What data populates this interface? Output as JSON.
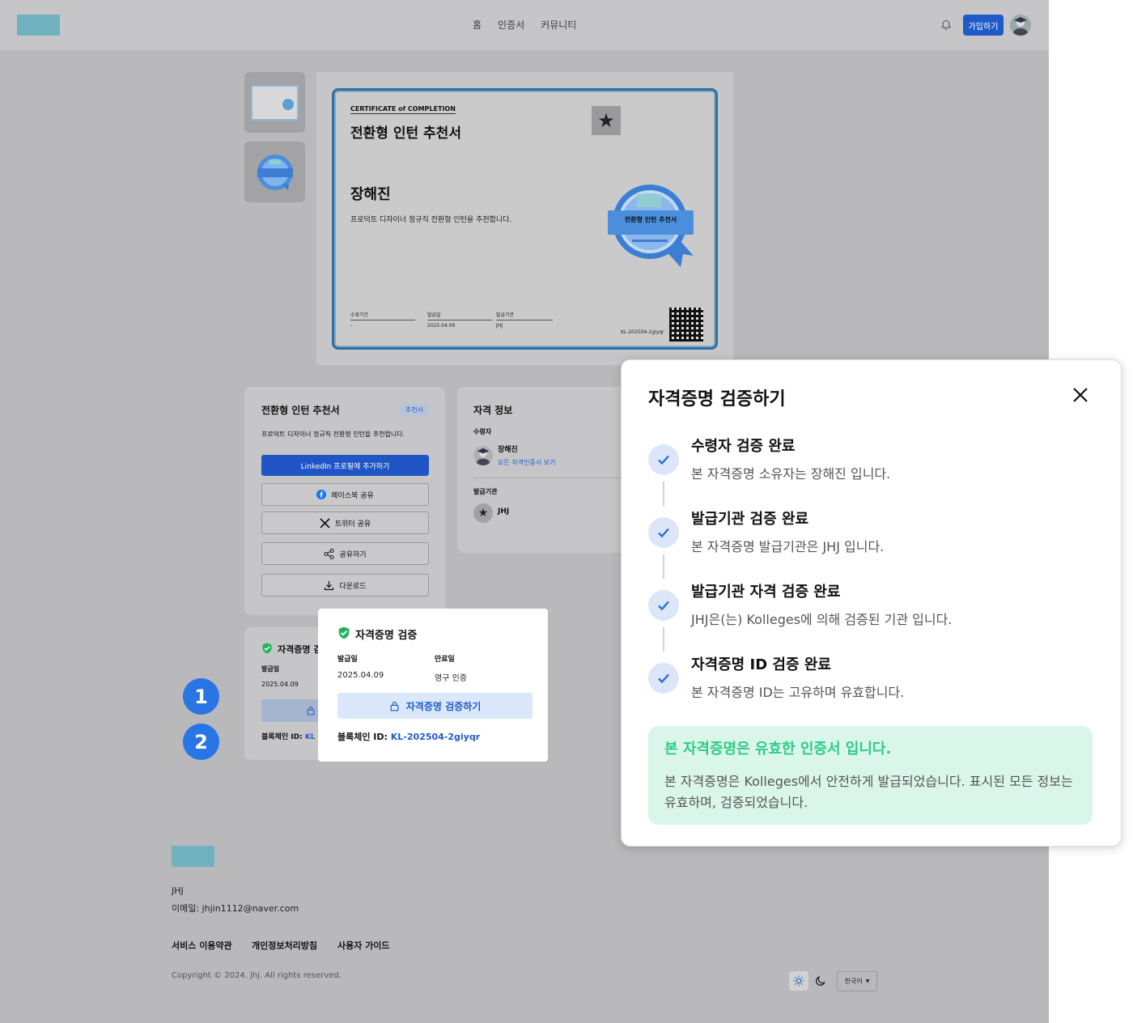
{
  "nav": {
    "items": [
      "홈",
      "인증서",
      "커뮤니티"
    ],
    "join_label": "가입하기"
  },
  "certificate": {
    "small_heading": "CERTIFICATE of COMPLETION",
    "title": "전환형 인턴 추천서",
    "recipient": "장해진",
    "description": "프로덕트 디자이너 정규직 전환형 인턴을 추천합니다.",
    "fields": [
      {
        "label": "수료기간",
        "value": "-"
      },
      {
        "label": "발급일",
        "value": "2025.04.09"
      },
      {
        "label": "발급기관",
        "value": "JHJ"
      }
    ],
    "cert_id": "KL-202504-2giyqr",
    "badge_label": "전환형 인턴 추천서"
  },
  "share_card": {
    "title": "전환형 인턴 추천서",
    "tag": "추천서",
    "description": "프로덕트 디자이너 정규직 전환형 인턴을 추천합니다.",
    "linkedin": "LinkedIn 프로필에 추가하기",
    "facebook": "페이스북 공유",
    "twitter": "트위터 공유",
    "share": "공유하기",
    "download": "다운로드"
  },
  "info_card": {
    "title": "자격 정보",
    "recipient_label": "수령자",
    "recipient_name": "장해진",
    "recipient_link": "모든 자격인증서 보기",
    "issuer_label": "발급기관",
    "issuer_name": "JHJ"
  },
  "verify_card": {
    "title": "자격증명 검증",
    "title_partial": "자격증명 검",
    "issue_label": "발급일",
    "issue_value": "2025.04.09",
    "blockchain_label": "블록체인 ID:",
    "blockchain_partial": "KL"
  },
  "mini_popup": {
    "title": "자격증명 검증",
    "issue_label": "발급일",
    "issue_value": "2025.04.09",
    "expire_label": "만료일",
    "expire_value": "영구 인증",
    "verify_button": "자격증명 검증하기",
    "blockchain_label": "블록체인 ID:",
    "blockchain_value": "KL-202504-2giyqr"
  },
  "markers": [
    "1",
    "2"
  ],
  "modal": {
    "title": "자격증명 검증하기",
    "steps": [
      {
        "title": "수령자 검증 완료",
        "desc": "본 자격증명 소유자는 장해진 입니다."
      },
      {
        "title": "발급기관 검증 완료",
        "desc": "본 자격증명 발급기관은 JHJ 입니다."
      },
      {
        "title": "발급기관 자격 검증 완료",
        "desc": "JHJ은(는) Kolleges에 의해 검증된 기관 입니다."
      },
      {
        "title": "자격증명 ID 검증 완료",
        "desc": "본 자격증명 ID는 고유하며 유효합니다."
      }
    ],
    "valid_title": "본 자격증명은 유효한 인증서 입니다.",
    "valid_desc": "본 자격증명은 Kolleges에서 안전하게 발급되었습니다. 표시된 모든 정보는 유효하며, 검증되었습니다."
  },
  "footer": {
    "company": "JHJ",
    "email": "이메일: jhjin1112@naver.com",
    "links": [
      "서비스 이용약관",
      "개인정보처리방침",
      "사용자 가이드"
    ],
    "copyright": "Copyright © 2024. jhj.  All rights reserved.",
    "language": "한국어"
  },
  "colors": {
    "primary": "#1f5bc8",
    "success": "#2ecc86",
    "marker": "#2a75e6",
    "logo": "#6fb1bf"
  }
}
